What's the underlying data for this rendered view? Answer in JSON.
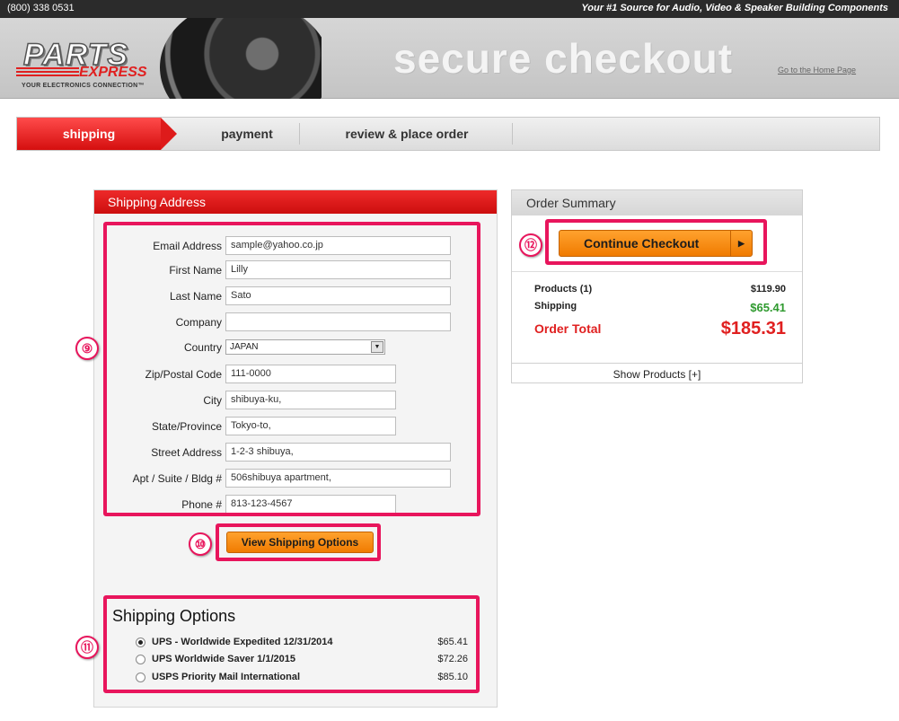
{
  "topbar": {
    "phone": "(800) 338 0531",
    "tagline": "Your #1 Source for Audio, Video & Speaker Building Components"
  },
  "header": {
    "logo_word1": "PARTS",
    "logo_word2": "EXPRESS",
    "logo_sub": "YOUR ELECTRONICS CONNECTION™",
    "title": "secure checkout",
    "home_link": "Go to the Home Page"
  },
  "steps": [
    {
      "label": "shipping",
      "active": true
    },
    {
      "label": "payment",
      "active": false
    },
    {
      "label": "review & place order",
      "active": false
    }
  ],
  "shipping_address": {
    "title": "Shipping Address",
    "fields": [
      {
        "label": "Email Address",
        "value": "sample@yahoo.co.jp"
      },
      {
        "label": "First Name",
        "value": "Lilly"
      },
      {
        "label": "Last Name",
        "value": "Sato"
      },
      {
        "label": "Company",
        "value": ""
      },
      {
        "label": "Country",
        "value": "JAPAN"
      },
      {
        "label": "Zip/Postal Code",
        "value": "111-0000"
      },
      {
        "label": "City",
        "value": "shibuya-ku,"
      },
      {
        "label": "State/Province",
        "value": "Tokyo-to,"
      },
      {
        "label": "Street Address",
        "value": "1-2-3 shibuya,"
      },
      {
        "label": "Apt / Suite / Bldg #",
        "value": "506shibuya apartment,"
      },
      {
        "label": "Phone #",
        "value": "813-123-4567"
      }
    ],
    "view_options_button": "View Shipping Options"
  },
  "shipping_options": {
    "title": "Shipping Options",
    "options": [
      {
        "name": "UPS - Worldwide Expedited 12/31/2014",
        "price": "$65.41",
        "selected": true
      },
      {
        "name": "UPS Worldwide Saver 1/1/2015",
        "price": "$72.26",
        "selected": false
      },
      {
        "name": "USPS Priority Mail International",
        "price": "$85.10",
        "selected": false
      }
    ]
  },
  "order_summary": {
    "title": "Order Summary",
    "continue_button": "Continue Checkout",
    "products_label": "Products  (1)",
    "products_value": "$119.90",
    "shipping_label": "Shipping",
    "shipping_value": "$65.41",
    "total_label": "Order Total",
    "total_value": "$185.31",
    "show_products": "Show Products [+]"
  },
  "annotations": [
    "⑨",
    "⑩",
    "⑪",
    "⑫"
  ],
  "colors": {
    "accent_red": "#de1b1b",
    "highlight_pink": "#e8155c",
    "button_orange": "#f7931e",
    "shipping_green": "#2f9a2f"
  }
}
